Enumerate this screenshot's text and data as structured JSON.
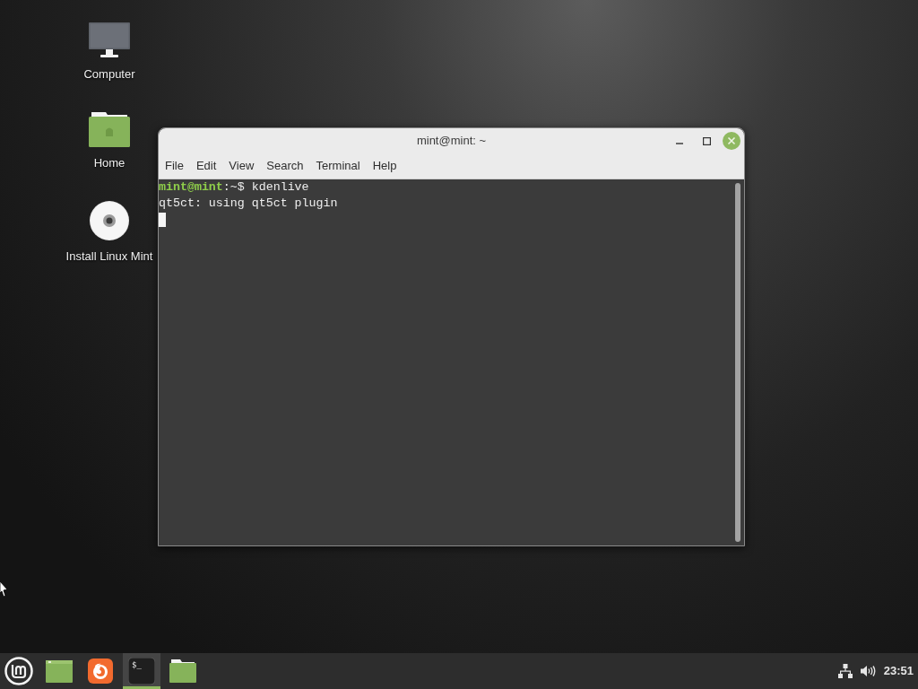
{
  "desktop": {
    "icons": [
      {
        "kind": "computer",
        "label": "Computer"
      },
      {
        "kind": "home",
        "label": "Home"
      },
      {
        "kind": "disc",
        "label": "Install Linux Mint"
      }
    ]
  },
  "terminal_window": {
    "title": "mint@mint: ~",
    "menu": [
      "File",
      "Edit",
      "View",
      "Search",
      "Terminal",
      "Help"
    ],
    "lines": [
      {
        "kind": "prompt",
        "user": "mint@mint",
        "prompt": ":~$",
        "command": "kdenlive"
      },
      {
        "kind": "output",
        "text": "qt5ct: using qt5ct plugin"
      }
    ]
  },
  "taskbar": {
    "apps": [
      {
        "kind": "desktop",
        "active": false
      },
      {
        "kind": "browser",
        "active": false
      },
      {
        "kind": "terminal",
        "glyph": "$_",
        "active": true
      },
      {
        "kind": "folder",
        "active": false
      }
    ],
    "clock": "23:51"
  }
}
